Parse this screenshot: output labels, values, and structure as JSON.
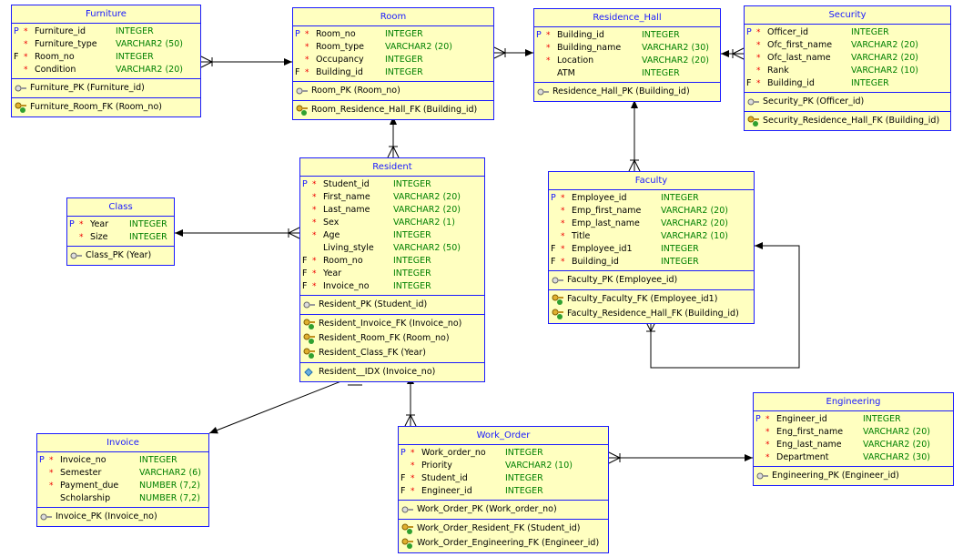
{
  "entities": [
    {
      "id": "furniture",
      "name": "Furniture",
      "columns": [
        {
          "flag": "P",
          "req": true,
          "name": "Furniture_id",
          "type": "INTEGER"
        },
        {
          "flag": "",
          "req": true,
          "name": "Furniture_type",
          "type": "VARCHAR2 (50)"
        },
        {
          "flag": "F",
          "req": true,
          "name": "Room_no",
          "type": "INTEGER"
        },
        {
          "flag": "",
          "req": true,
          "name": "Condition",
          "type": "VARCHAR2 (20)"
        }
      ],
      "pk": [
        "Furniture_PK (Furniture_id)"
      ],
      "fk": [
        "Furniture_Room_FK (Room_no)"
      ],
      "idx": []
    },
    {
      "id": "room",
      "name": "Room",
      "columns": [
        {
          "flag": "P",
          "req": true,
          "name": "Room_no",
          "type": "INTEGER"
        },
        {
          "flag": "",
          "req": true,
          "name": "Room_type",
          "type": "VARCHAR2 (20)"
        },
        {
          "flag": "",
          "req": true,
          "name": "Occupancy",
          "type": "INTEGER"
        },
        {
          "flag": "F",
          "req": true,
          "name": "Building_id",
          "type": "INTEGER"
        }
      ],
      "pk": [
        "Room_PK (Room_no)"
      ],
      "fk": [
        "Room_Residence_Hall_FK (Building_id)"
      ],
      "idx": []
    },
    {
      "id": "residence-hall",
      "name": "Residence_Hall",
      "columns": [
        {
          "flag": "P",
          "req": true,
          "name": "Building_id",
          "type": "INTEGER"
        },
        {
          "flag": "",
          "req": true,
          "name": "Building_name",
          "type": "VARCHAR2 (30)"
        },
        {
          "flag": "",
          "req": true,
          "name": "Location",
          "type": "VARCHAR2 (20)"
        },
        {
          "flag": "",
          "req": false,
          "name": "ATM",
          "type": "INTEGER"
        }
      ],
      "pk": [
        "Residence_Hall_PK (Building_id)"
      ],
      "fk": [],
      "idx": []
    },
    {
      "id": "security",
      "name": "Security",
      "columns": [
        {
          "flag": "P",
          "req": true,
          "name": "Officer_id",
          "type": "INTEGER"
        },
        {
          "flag": "",
          "req": true,
          "name": "Ofc_first_name",
          "type": "VARCHAR2 (20)"
        },
        {
          "flag": "",
          "req": true,
          "name": "Ofc_last_name",
          "type": "VARCHAR2 (20)"
        },
        {
          "flag": "",
          "req": true,
          "name": "Rank",
          "type": "VARCHAR2 (10)"
        },
        {
          "flag": "F",
          "req": true,
          "name": "Building_id",
          "type": "INTEGER"
        }
      ],
      "pk": [
        "Security_PK (Officer_id)"
      ],
      "fk": [
        "Security_Residence_Hall_FK (Building_id)"
      ],
      "idx": []
    },
    {
      "id": "resident",
      "name": "Resident",
      "columns": [
        {
          "flag": "P",
          "req": true,
          "name": "Student_id",
          "type": "INTEGER"
        },
        {
          "flag": "",
          "req": true,
          "name": "First_name",
          "type": "VARCHAR2 (20)"
        },
        {
          "flag": "",
          "req": true,
          "name": "Last_name",
          "type": "VARCHAR2 (20)"
        },
        {
          "flag": "",
          "req": true,
          "name": "Sex",
          "type": "VARCHAR2 (1)"
        },
        {
          "flag": "",
          "req": true,
          "name": "Age",
          "type": "INTEGER"
        },
        {
          "flag": "",
          "req": false,
          "name": "Living_style",
          "type": "VARCHAR2 (50)"
        },
        {
          "flag": "F",
          "req": true,
          "name": "Room_no",
          "type": "INTEGER"
        },
        {
          "flag": "F",
          "req": true,
          "name": "Year",
          "type": "INTEGER"
        },
        {
          "flag": "F",
          "req": true,
          "name": "Invoice_no",
          "type": "INTEGER"
        }
      ],
      "pk": [
        "Resident_PK (Student_id)"
      ],
      "fk": [
        "Resident_Invoice_FK (Invoice_no)",
        "Resident_Room_FK (Room_no)",
        "Resident_Class_FK (Year)"
      ],
      "idx": [
        "Resident__IDX (Invoice_no)"
      ]
    },
    {
      "id": "class",
      "name": "Class",
      "columns": [
        {
          "flag": "P",
          "req": true,
          "name": "Year",
          "type": "INTEGER"
        },
        {
          "flag": "",
          "req": true,
          "name": "Size",
          "type": "INTEGER"
        }
      ],
      "pk": [
        "Class_PK (Year)"
      ],
      "fk": [],
      "idx": []
    },
    {
      "id": "faculty",
      "name": "Faculty",
      "columns": [
        {
          "flag": "P",
          "req": true,
          "name": "Employee_id",
          "type": "INTEGER"
        },
        {
          "flag": "",
          "req": true,
          "name": "Emp_first_name",
          "type": "VARCHAR2 (20)"
        },
        {
          "flag": "",
          "req": true,
          "name": "Emp_last_name",
          "type": "VARCHAR2 (20)"
        },
        {
          "flag": "",
          "req": true,
          "name": "Title",
          "type": "VARCHAR2 (10)"
        },
        {
          "flag": "F",
          "req": true,
          "name": "Employee_id1",
          "type": "INTEGER"
        },
        {
          "flag": "F",
          "req": true,
          "name": "Building_id",
          "type": "INTEGER"
        }
      ],
      "pk": [
        "Faculty_PK (Employee_id)"
      ],
      "fk": [
        "Faculty_Faculty_FK (Employee_id1)",
        "Faculty_Residence_Hall_FK (Building_id)"
      ],
      "idx": []
    },
    {
      "id": "invoice",
      "name": "Invoice",
      "columns": [
        {
          "flag": "P",
          "req": true,
          "name": "Invoice_no",
          "type": "INTEGER"
        },
        {
          "flag": "",
          "req": true,
          "name": "Semester",
          "type": "VARCHAR2 (6)"
        },
        {
          "flag": "",
          "req": true,
          "name": "Payment_due",
          "type": "NUMBER (7,2)"
        },
        {
          "flag": "",
          "req": false,
          "name": "Scholarship",
          "type": "NUMBER (7,2)"
        }
      ],
      "pk": [
        "Invoice_PK (Invoice_no)"
      ],
      "fk": [],
      "idx": []
    },
    {
      "id": "work-order",
      "name": "Work_Order",
      "columns": [
        {
          "flag": "P",
          "req": true,
          "name": "Work_order_no",
          "type": "INTEGER"
        },
        {
          "flag": "",
          "req": true,
          "name": "Priority",
          "type": "VARCHAR2 (10)"
        },
        {
          "flag": "F",
          "req": true,
          "name": "Student_id",
          "type": "INTEGER"
        },
        {
          "flag": "F",
          "req": true,
          "name": "Engineer_id",
          "type": "INTEGER"
        }
      ],
      "pk": [
        "Work_Order_PK (Work_order_no)"
      ],
      "fk": [
        "Work_Order_Resident_FK (Student_id)",
        "Work_Order_Engineering_FK (Engineer_id)"
      ],
      "idx": []
    },
    {
      "id": "engineering",
      "name": "Engineering",
      "columns": [
        {
          "flag": "P",
          "req": true,
          "name": "Engineer_id",
          "type": "INTEGER"
        },
        {
          "flag": "",
          "req": true,
          "name": "Eng_first_name",
          "type": "VARCHAR2 (20)"
        },
        {
          "flag": "",
          "req": true,
          "name": "Eng_last_name",
          "type": "VARCHAR2 (20)"
        },
        {
          "flag": "",
          "req": true,
          "name": "Department",
          "type": "VARCHAR2 (30)"
        }
      ],
      "pk": [
        "Engineering_PK (Engineer_id)"
      ],
      "fk": [],
      "idx": []
    }
  ],
  "colors": {
    "border": "#1a1aff",
    "fill": "#ffffc0",
    "type": "#008000",
    "required": "#e00000"
  }
}
